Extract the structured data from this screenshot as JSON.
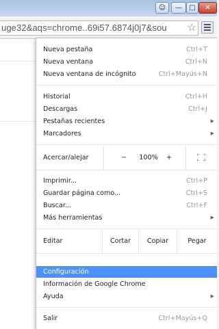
{
  "window": {
    "user_icon": "user-icon",
    "minimize_icon": "minimize-icon",
    "maximize_icon": "maximize-icon",
    "close_icon": "close-icon"
  },
  "toolbar": {
    "url": "uge32&aqs=chrome..69i57.6874j0j7&sou",
    "star_icon": "star-icon",
    "menu_icon": "hamburger-menu-icon"
  },
  "menu": {
    "new_tab": {
      "label": "Nueva pestaña",
      "shortcut": "Ctrl+T"
    },
    "new_window": {
      "label": "Nueva ventana",
      "shortcut": "Ctrl+N"
    },
    "incognito": {
      "label": "Nueva ventana de incógnito",
      "shortcut": "Ctrl+Mayús+N"
    },
    "history": {
      "label": "Historial",
      "shortcut": "Ctrl+H"
    },
    "downloads": {
      "label": "Descargas",
      "shortcut": "Ctrl+J"
    },
    "recent_tabs": {
      "label": "Pestañas recientes"
    },
    "bookmarks": {
      "label": "Marcadores"
    },
    "zoom": {
      "label": "Acercar/alejar",
      "minus": "−",
      "value": "100%",
      "plus": "+",
      "fullscreen_icon": "fullscreen-icon"
    },
    "print": {
      "label": "Imprimir...",
      "shortcut": "Ctrl+P"
    },
    "save_page": {
      "label": "Guardar página como...",
      "shortcut": "Ctrl+S"
    },
    "find": {
      "label": "Buscar...",
      "shortcut": "Ctrl+F"
    },
    "more_tools": {
      "label": "Más herramientas"
    },
    "edit": {
      "label": "Editar",
      "cut": "Cortar",
      "copy": "Copiar",
      "paste": "Pegar"
    },
    "settings": {
      "label": "Configuración"
    },
    "about": {
      "label": "Información de Google Chrome"
    },
    "help": {
      "label": "Ayuda"
    },
    "exit": {
      "label": "Salir",
      "shortcut": "Ctrl+Mayús+Q"
    }
  },
  "colors": {
    "highlight": "#4d90fe"
  }
}
